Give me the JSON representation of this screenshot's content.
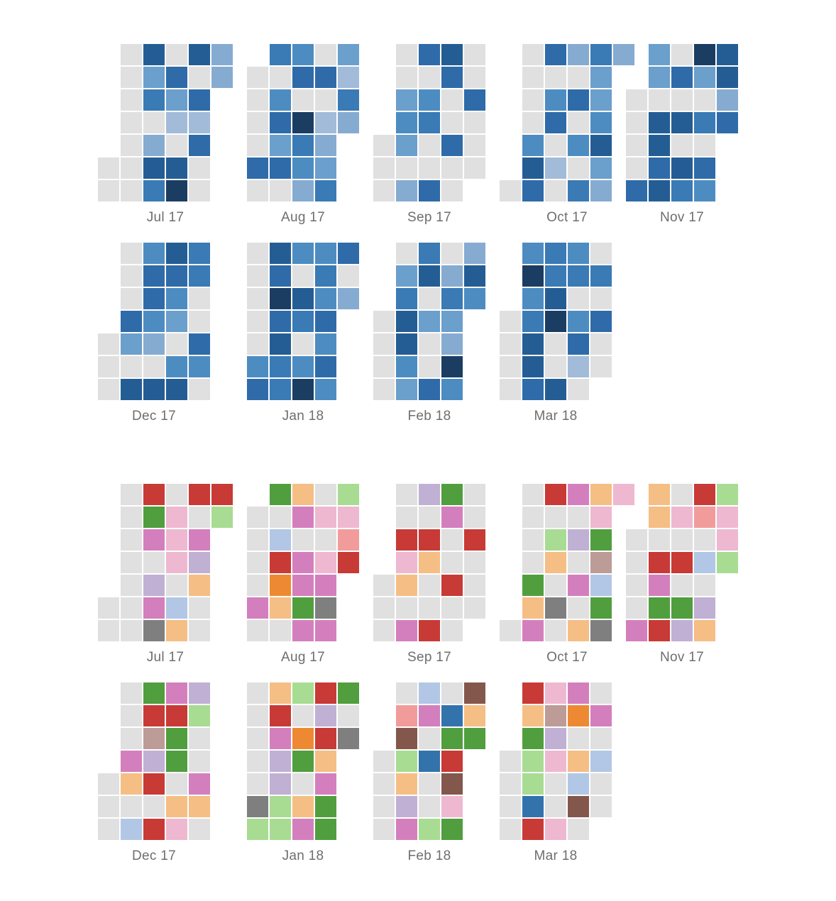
{
  "chart_data": [
    {
      "type": "heatmap",
      "title": "",
      "color_scheme": "sequential-blues",
      "empty_color": "#e0e0e0",
      "palette": {
        "1": "#a2bbd9",
        "2": "#86abd1",
        "3": "#6b9fcc",
        "4": "#4d8cc1",
        "5": "#3a7ab5",
        "6": "#2f6ba8",
        "7": "#245d94",
        "8": "#1b3d62"
      },
      "months": [
        {
          "label": "Jul 17",
          "start": 5,
          "days": [
            0,
            0,
            0,
            0,
            0,
            0,
            0,
            0,
            0,
            7,
            3,
            5,
            0,
            2,
            7,
            5,
            0,
            6,
            3,
            1,
            0,
            7,
            8,
            7,
            0,
            6,
            1,
            6,
            0,
            0,
            2,
            2
          ]
        },
        {
          "label": "Aug 17",
          "start": 1,
          "days": [
            0,
            0,
            0,
            0,
            6,
            0,
            5,
            0,
            4,
            6,
            3,
            6,
            0,
            4,
            6,
            0,
            8,
            5,
            4,
            2,
            0,
            6,
            0,
            1,
            2,
            3,
            5,
            3,
            1,
            5,
            2
          ]
        },
        {
          "label": "Sep 17",
          "start": 4,
          "days": [
            0,
            0,
            0,
            0,
            0,
            3,
            4,
            3,
            0,
            2,
            6,
            0,
            4,
            5,
            0,
            0,
            6,
            7,
            6,
            0,
            0,
            6,
            0,
            0,
            0,
            0,
            6,
            0,
            0,
            0
          ]
        },
        {
          "label": "Oct 17",
          "start": 6,
          "days": [
            0,
            0,
            0,
            0,
            0,
            4,
            7,
            6,
            6,
            0,
            4,
            6,
            0,
            1,
            0,
            2,
            0,
            6,
            0,
            4,
            0,
            5,
            5,
            3,
            3,
            4,
            7,
            3,
            2,
            2
          ]
        },
        {
          "label": "Nov 17",
          "start": 2,
          "days": [
            0,
            0,
            0,
            0,
            6,
            3,
            3,
            0,
            7,
            7,
            6,
            7,
            0,
            6,
            0,
            7,
            0,
            7,
            5,
            8,
            3,
            0,
            5,
            0,
            6,
            4,
            7,
            7,
            2,
            6
          ]
        },
        {
          "label": "Dec 17",
          "start": 4,
          "days": [
            0,
            0,
            0,
            0,
            0,
            0,
            6,
            3,
            0,
            7,
            4,
            6,
            6,
            4,
            2,
            0,
            7,
            7,
            6,
            4,
            3,
            0,
            4,
            7,
            5,
            5,
            0,
            0,
            6,
            4,
            0
          ]
        },
        {
          "label": "Jan 18",
          "start": 0,
          "days": [
            0,
            0,
            0,
            0,
            0,
            4,
            6,
            7,
            6,
            8,
            6,
            7,
            5,
            5,
            4,
            0,
            7,
            5,
            0,
            4,
            8,
            4,
            5,
            4,
            6,
            4,
            6,
            4,
            6,
            0,
            2
          ]
        },
        {
          "label": "Feb 18",
          "start": 3,
          "days": [
            0,
            0,
            0,
            0,
            0,
            3,
            5,
            7,
            7,
            4,
            3,
            5,
            7,
            0,
            3,
            0,
            0,
            6,
            0,
            2,
            5,
            3,
            2,
            8,
            4,
            2,
            7,
            4
          ]
        },
        {
          "label": "Mar 18",
          "start": 3,
          "days": [
            0,
            0,
            0,
            0,
            4,
            8,
            4,
            5,
            7,
            7,
            6,
            5,
            5,
            7,
            8,
            0,
            0,
            7,
            4,
            5,
            0,
            4,
            6,
            1,
            0,
            0,
            5,
            0,
            6,
            0,
            0
          ]
        }
      ]
    },
    {
      "type": "heatmap",
      "title": "",
      "color_scheme": "categorical",
      "empty_color": "#e0e0e0",
      "palette": {
        "R": "#c83a36",
        "G": "#519e3f",
        "P": "#d47fbd",
        "L": "#c0b0d4",
        "K": "#eeb8d0",
        "O": "#f5be85",
        "B": "#b1c7e5",
        "A": "#7f7f7f",
        "N": "#a8dc92",
        "E": "#ee8933",
        "S": "#f19c9b",
        "T": "#bd9b97",
        "U": "#3373ac",
        "M": "#84574d"
      },
      "months": [
        {
          "label": "Jul 17",
          "start": 5,
          "days": [
            "",
            "",
            "",
            "",
            "",
            "",
            "",
            "",
            "",
            "R",
            "G",
            "P",
            "",
            "L",
            "P",
            "A",
            "",
            "K",
            "K",
            "K",
            "",
            "B",
            "O",
            "R",
            "",
            "P",
            "L",
            "O",
            "",
            "",
            "R",
            "N"
          ]
        },
        {
          "label": "Aug 17",
          "start": 1,
          "days": [
            "",
            "",
            "",
            "",
            "P",
            "",
            "G",
            "",
            "B",
            "R",
            "E",
            "O",
            "",
            "O",
            "P",
            "",
            "P",
            "P",
            "G",
            "P",
            "",
            "K",
            "",
            "K",
            "P",
            "A",
            "P",
            "N",
            "K",
            "S",
            "R"
          ]
        },
        {
          "label": "Sep 17",
          "start": 4,
          "days": [
            "",
            "",
            "",
            "",
            "",
            "R",
            "K",
            "O",
            "",
            "P",
            "L",
            "",
            "R",
            "O",
            "",
            "",
            "R",
            "G",
            "P",
            "",
            "",
            "R",
            "",
            "",
            "",
            "",
            "R",
            "",
            "",
            ""
          ]
        },
        {
          "label": "Oct 17",
          "start": 6,
          "days": [
            "",
            "",
            "",
            "",
            "",
            "G",
            "O",
            "P",
            "R",
            "",
            "N",
            "O",
            "",
            "A",
            "",
            "P",
            "",
            "L",
            "",
            "P",
            "",
            "O",
            "O",
            "K",
            "G",
            "T",
            "B",
            "G",
            "A",
            "K"
          ]
        },
        {
          "label": "Nov 17",
          "start": 2,
          "days": [
            "",
            "",
            "",
            "",
            "P",
            "O",
            "O",
            "",
            "R",
            "P",
            "G",
            "R",
            "",
            "K",
            "",
            "R",
            "",
            "G",
            "L",
            "R",
            "S",
            "",
            "B",
            "",
            "L",
            "O",
            "N",
            "K",
            "K",
            "N"
          ]
        },
        {
          "label": "Dec 17",
          "start": 4,
          "days": [
            "",
            "",
            "",
            "",
            "",
            "",
            "P",
            "O",
            "",
            "B",
            "G",
            "R",
            "T",
            "L",
            "R",
            "",
            "R",
            "P",
            "R",
            "G",
            "G",
            "",
            "O",
            "K",
            "L",
            "N",
            "",
            "",
            "P",
            "O",
            ""
          ]
        },
        {
          "label": "Jan 18",
          "start": 0,
          "days": [
            "",
            "",
            "",
            "",
            "",
            "A",
            "N",
            "O",
            "R",
            "P",
            "L",
            "L",
            "N",
            "N",
            "N",
            "",
            "E",
            "G",
            "",
            "O",
            "P",
            "R",
            "L",
            "R",
            "O",
            "P",
            "G",
            "G",
            "G",
            "",
            "A"
          ]
        },
        {
          "label": "Feb 18",
          "start": 3,
          "days": [
            "",
            "",
            "",
            "",
            "",
            "S",
            "M",
            "N",
            "O",
            "L",
            "P",
            "B",
            "P",
            "",
            "U",
            "",
            "",
            "N",
            "",
            "U",
            "G",
            "R",
            "M",
            "K",
            "G",
            "M",
            "O",
            "G"
          ]
        },
        {
          "label": "Mar 18",
          "start": 3,
          "days": [
            "",
            "",
            "",
            "",
            "R",
            "O",
            "G",
            "N",
            "N",
            "U",
            "R",
            "K",
            "T",
            "L",
            "K",
            "",
            "",
            "K",
            "P",
            "E",
            "",
            "O",
            "B",
            "M",
            "",
            "",
            "P",
            "",
            "B",
            "",
            ""
          ]
        }
      ]
    }
  ]
}
